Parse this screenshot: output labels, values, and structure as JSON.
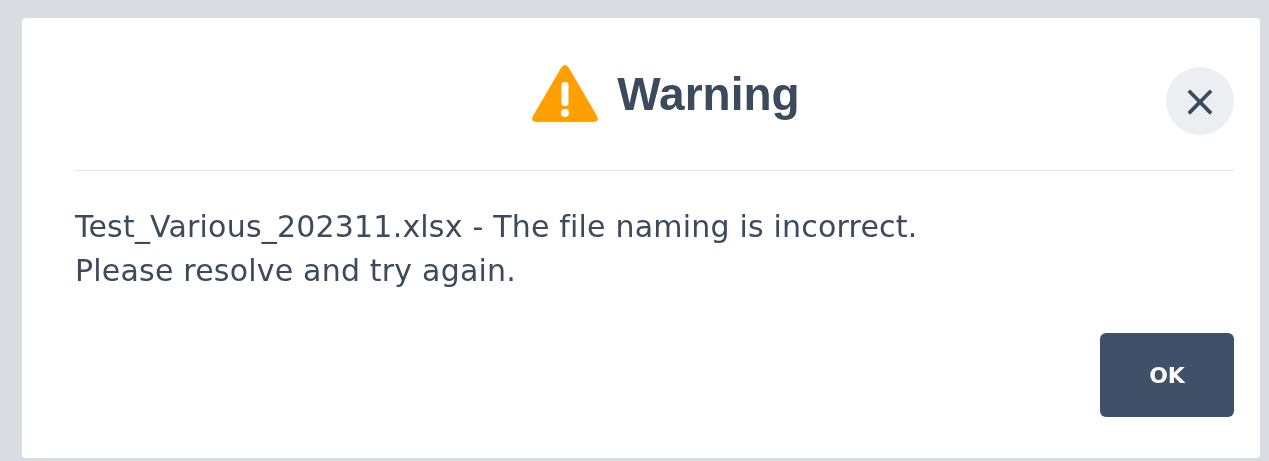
{
  "dialog": {
    "title": "Warning",
    "close": "×",
    "message": "Test_Various_202311.xlsx - The file naming is incorrect.\nPlease resolve and try again.",
    "buttons": [
      "OK"
    ]
  }
}
